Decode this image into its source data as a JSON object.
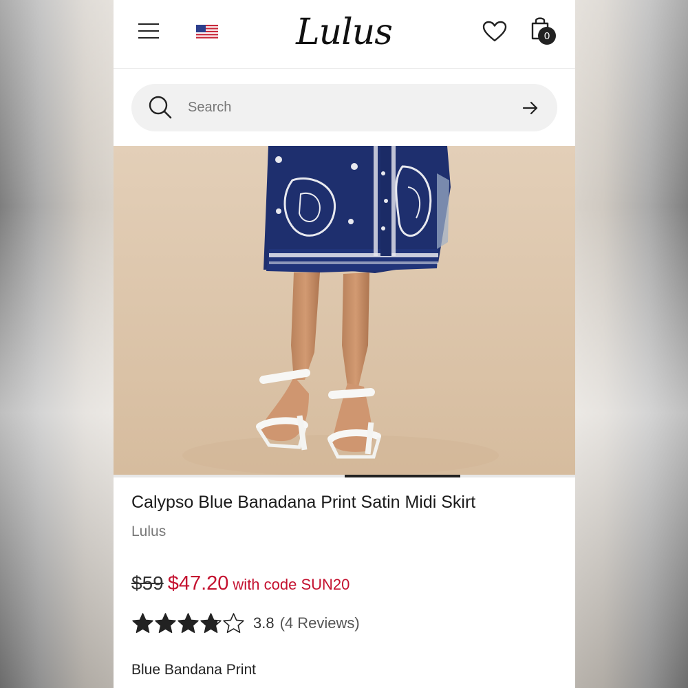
{
  "header": {
    "logo_text": "Lulus",
    "cart_count": "0",
    "icons": [
      "menu-icon",
      "us-flag-icon",
      "heart-icon",
      "shopping-bag-icon"
    ]
  },
  "search": {
    "placeholder": "Search",
    "icons": [
      "search-icon",
      "arrow-right-icon"
    ]
  },
  "gallery": {
    "image_description_icon": "product-photo",
    "active_slide_fraction": 0.25
  },
  "product": {
    "title": "Calypso Blue Banadana Print Satin Midi Skirt",
    "brand": "Lulus",
    "price_original": "$59",
    "price_sale": "$47.20",
    "price_code_text": "with code SUN20",
    "rating_value": "3.8",
    "review_count": "(4 Reviews)",
    "rating_stars": 3.8,
    "rating_max": 5,
    "color": "Blue Bandana Print"
  },
  "colors": {
    "sale_red": "#c41230",
    "text_dark": "#1a1a1a",
    "text_muted": "#777777",
    "search_bg": "#f1f1f1"
  }
}
